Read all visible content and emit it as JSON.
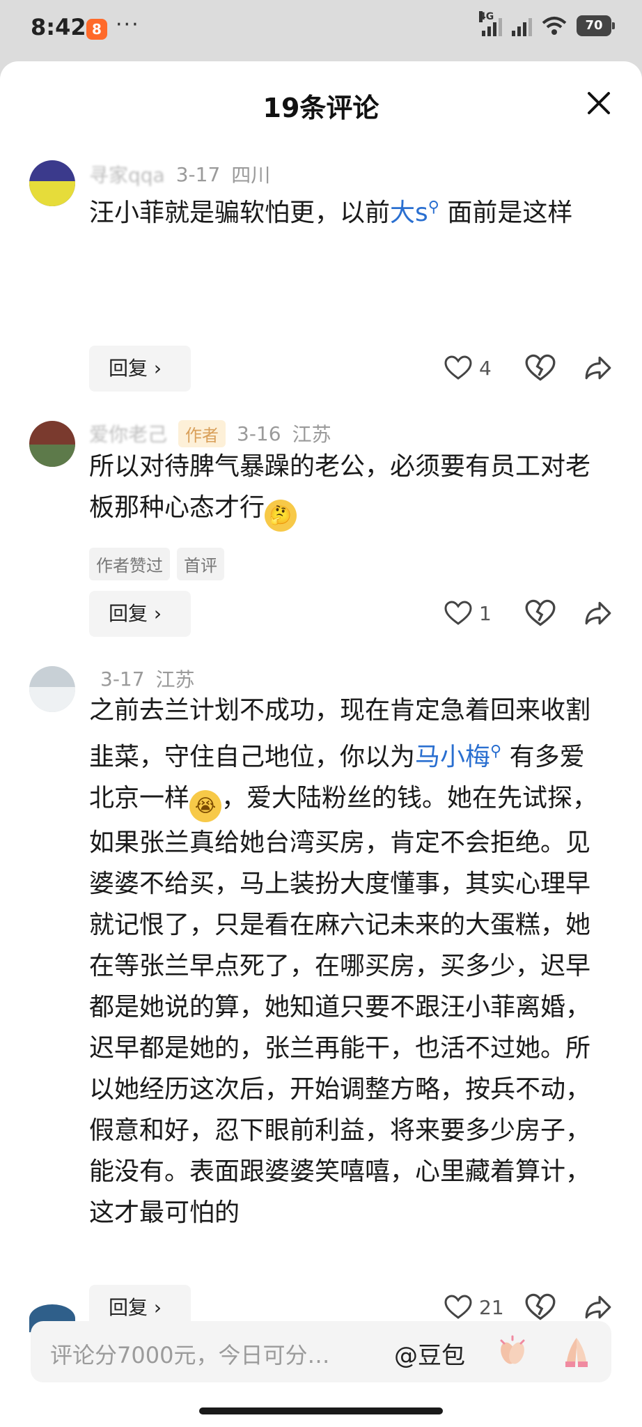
{
  "status": {
    "time": "8:42",
    "app_badge": "8",
    "more": "···",
    "network": "4G",
    "battery": "70"
  },
  "sheet": {
    "title": "19条评论"
  },
  "comments": [
    {
      "user": "寻家qqa",
      "date": "3-17",
      "location": "四川",
      "text_before": "汪小菲就是骗软怕更，以前",
      "link": "大s",
      "text_after": " 面前是这样",
      "reply": "回复",
      "likes": "4"
    },
    {
      "user": "爱你老己",
      "author_tag": "作者",
      "date": "3-16",
      "location": "江苏",
      "text": "所以对待脾气暴躁的老公，必须要有员工对老板那种心态才行",
      "badges": [
        "作者赞过",
        "首评"
      ],
      "reply": "回复",
      "likes": "1"
    },
    {
      "user": "",
      "date": "3-17",
      "location": "江苏",
      "text_before": "之前去兰计划不成功，现在肯定急着回来收割韭菜，守住自己地位，你以为",
      "link": "马小梅",
      "text_mid": " 有多爱北京一样",
      "text_after": "，爱大陆粉丝的钱。她在先试探，如果张兰真给她台湾买房，肯定不会拒绝。见婆婆不给买，马上装扮大度懂事，其实心理早就记恨了，只是看在麻六记未来的大蛋糕，她在等张兰早点死了，在哪买房，买多少，迟早都是她说的算，她知道只要不跟汪小菲离婚，迟早都是她的，张兰再能干，也活不过她。所以她经历这次后，开始调整方略，按兵不动，假意和好，忍下眼前利益，将来要多少房子，能没有。表面跟婆婆笑嘻嘻，心里藏着算计，这才最可怕的",
      "reply": "回复",
      "likes": "21"
    }
  ],
  "input": {
    "placeholder": "评论分7000元，今日可分…",
    "mention": "@豆包"
  }
}
